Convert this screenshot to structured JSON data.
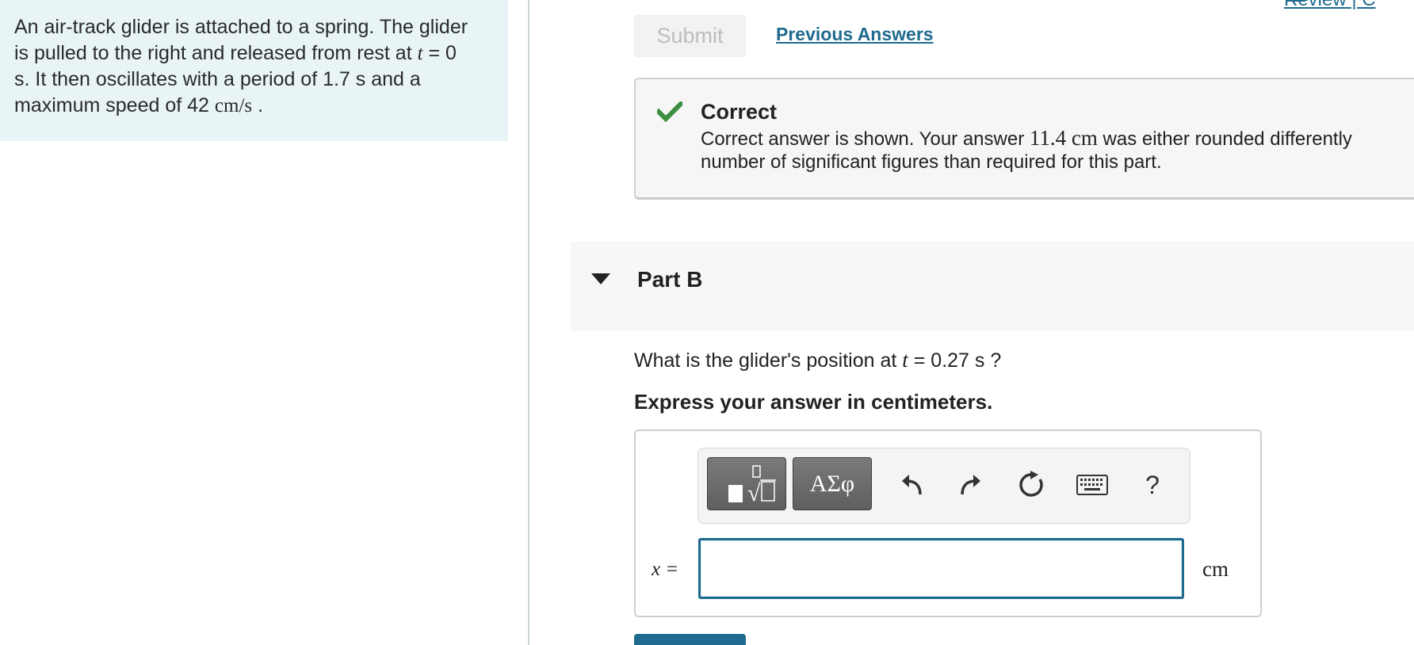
{
  "problem": {
    "line1": "An air-track glider is attached to a spring. The glider",
    "line2_pre": "is pulled to the right and released from rest at ",
    "line2_var": "t",
    "line2_post": " = 0",
    "line3": "s. It then oscillates with a period of 1.7 s and a",
    "line4_pre": "maximum speed of 42 ",
    "line4_unit": "cm/s",
    "line4_post": " ."
  },
  "header": {
    "review_link": "Review | C"
  },
  "part_a": {
    "submit_label": "Submit",
    "previous_answers_label": "Previous Answers",
    "feedback": {
      "title": "Correct",
      "text_pre": "Correct answer is shown. Your answer ",
      "answer_value": "11.4 cm",
      "text_post": " was either rounded differently",
      "text_line2": "number of significant figures than required for this part."
    }
  },
  "part_b": {
    "title": "Part B",
    "question_pre": "What is the glider's position at ",
    "question_var": "t",
    "question_post": " = 0.27 s ?",
    "instruction": "Express your answer in centimeters.",
    "toolbar": {
      "templates_icon": "templates-icon",
      "greek_label": "ΑΣφ",
      "undo_icon": "undo-icon",
      "redo_icon": "redo-icon",
      "reset_icon": "reset-icon",
      "keyboard_icon": "keyboard-icon",
      "help_label": "?"
    },
    "input_label": "x =",
    "input_value": "",
    "unit": "cm"
  },
  "colors": {
    "accent": "#1f6a8f",
    "success": "#3e8e41",
    "panel": "#e8f4f6"
  }
}
